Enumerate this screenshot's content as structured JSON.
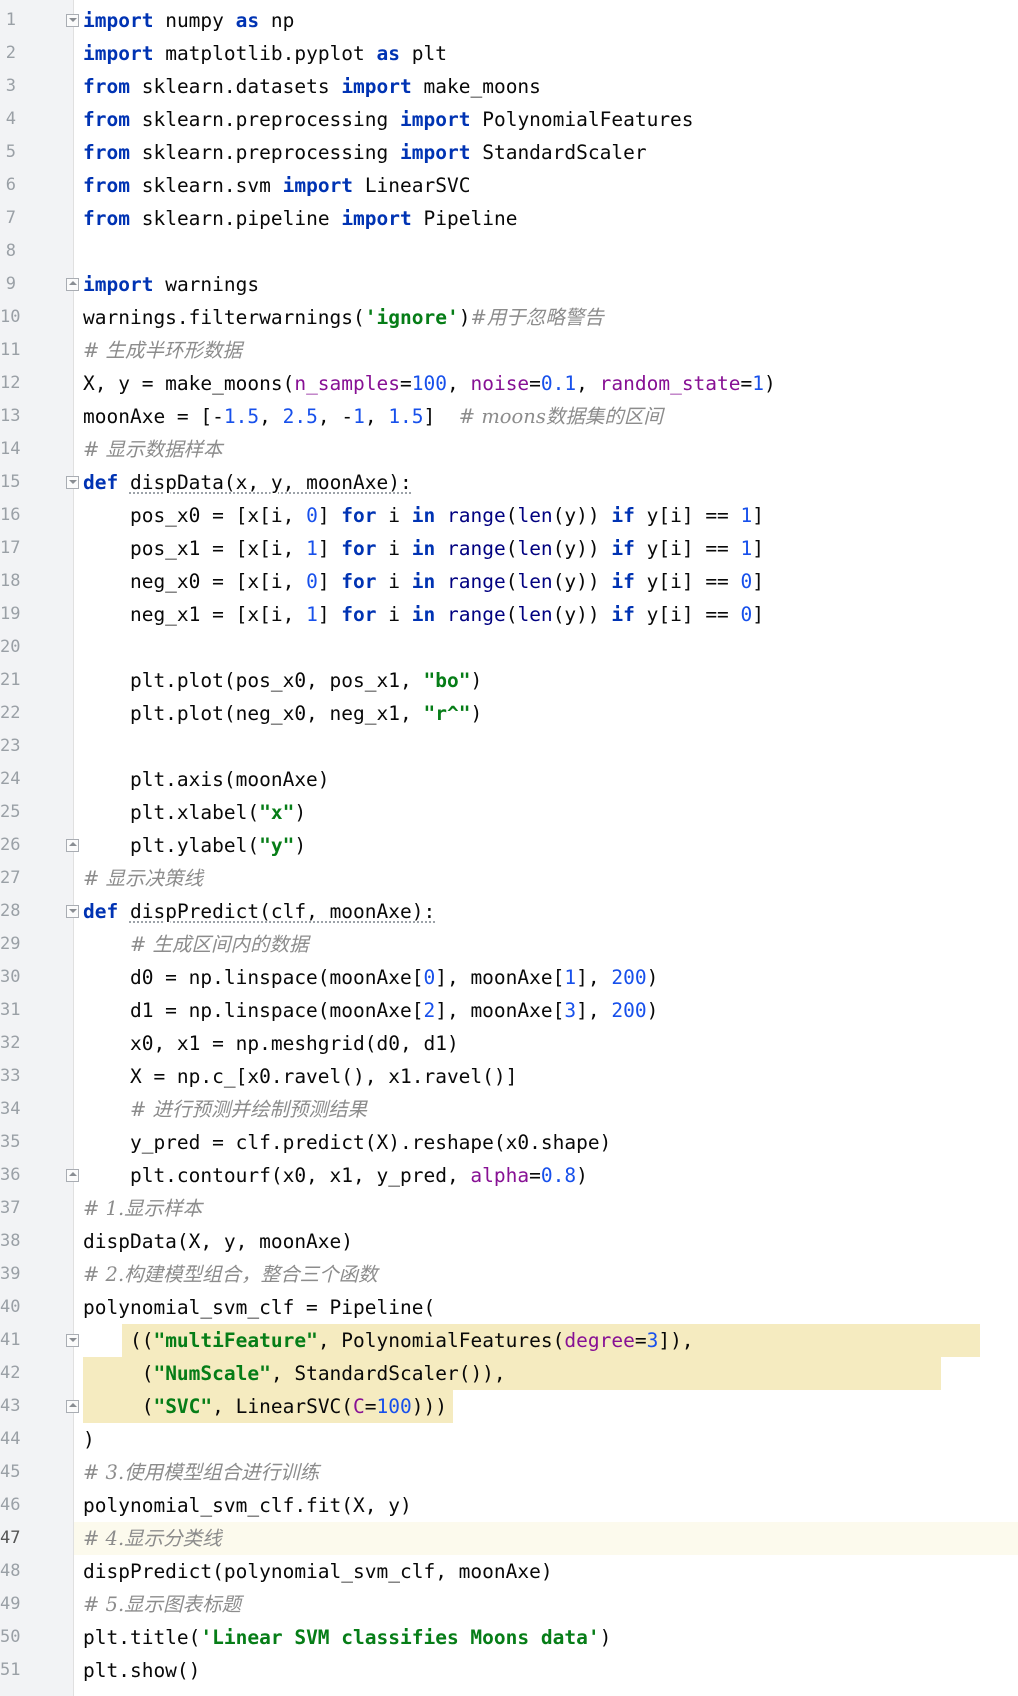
{
  "editor": {
    "line_numbers": [
      "1",
      "2",
      "3",
      "4",
      "5",
      "6",
      "7",
      "8",
      "9",
      "10",
      "11",
      "12",
      "13",
      "14",
      "15",
      "16",
      "17",
      "18",
      "19",
      "20",
      "21",
      "22",
      "23",
      "24",
      "25",
      "26",
      "27",
      "28",
      "29",
      "30",
      "31",
      "32",
      "33",
      "34",
      "35",
      "36",
      "37",
      "38",
      "39",
      "40",
      "41",
      "42",
      "43",
      "44",
      "45",
      "46",
      "47",
      "48",
      "49",
      "50",
      "51"
    ],
    "current_line": 47,
    "selected_lines": [
      41,
      42,
      43
    ],
    "fold_markers": [
      {
        "line": 1,
        "state": "open"
      },
      {
        "line": 9,
        "state": "close"
      },
      {
        "line": 15,
        "state": "open"
      },
      {
        "line": 26,
        "state": "close"
      },
      {
        "line": 28,
        "state": "open"
      },
      {
        "line": 36,
        "state": "close"
      },
      {
        "line": 41,
        "state": "open"
      },
      {
        "line": 43,
        "state": "close"
      }
    ],
    "lines": [
      [
        [
          "kw",
          "import"
        ],
        [
          "",
          "numpy"
        ],
        [
          "kw",
          "as"
        ],
        [
          "",
          "np"
        ]
      ],
      [
        [
          "kw",
          "import"
        ],
        [
          "",
          "matplotlib.pyplot"
        ],
        [
          "kw",
          "as"
        ],
        [
          "",
          "plt"
        ]
      ],
      [
        [
          "kw",
          "from"
        ],
        [
          "",
          "sklearn.datasets"
        ],
        [
          "kw",
          "import"
        ],
        [
          "",
          "make_moons"
        ]
      ],
      [
        [
          "kw",
          "from"
        ],
        [
          "",
          "sklearn.preprocessing"
        ],
        [
          "kw",
          "import"
        ],
        [
          "",
          "PolynomialFeatures"
        ]
      ],
      [
        [
          "kw",
          "from"
        ],
        [
          "",
          "sklearn.preprocessing"
        ],
        [
          "kw",
          "import"
        ],
        [
          "",
          "StandardScaler"
        ]
      ],
      [
        [
          "kw",
          "from"
        ],
        [
          "",
          "sklearn.svm"
        ],
        [
          "kw",
          "import"
        ],
        [
          "",
          "LinearSVC"
        ]
      ],
      [
        [
          "kw",
          "from"
        ],
        [
          "",
          "sklearn.pipeline"
        ],
        [
          "kw",
          "import"
        ],
        [
          "",
          "Pipeline"
        ]
      ],
      [],
      [
        [
          "kw",
          "import"
        ],
        [
          "",
          "warnings"
        ]
      ],
      [
        [
          "",
          "warnings.filterwarnings("
        ],
        [
          "str",
          "'ignore'"
        ],
        [
          "",
          ")"
        ],
        [
          "cmt",
          "#用于忽略警告"
        ]
      ],
      [
        [
          "cmt",
          "# 生成半环形数据"
        ]
      ],
      [
        [
          "",
          "X, y = make_moons("
        ],
        [
          "prm",
          "n_samples"
        ],
        [
          "",
          "="
        ],
        [
          "num",
          "100"
        ],
        [
          "",
          ", "
        ],
        [
          "prm",
          "noise"
        ],
        [
          "",
          "="
        ],
        [
          "num",
          "0.1"
        ],
        [
          "",
          ", "
        ],
        [
          "prm",
          "random_state"
        ],
        [
          "",
          "="
        ],
        [
          "num",
          "1"
        ],
        [
          "",
          ")"
        ]
      ],
      [
        [
          "",
          "moonAxe = [-"
        ],
        [
          "num",
          "1.5"
        ],
        [
          "",
          ", "
        ],
        [
          "num",
          "2.5"
        ],
        [
          "",
          ", -"
        ],
        [
          "num",
          "1"
        ],
        [
          "",
          ", "
        ],
        [
          "num",
          "1.5"
        ],
        [
          "",
          "]  "
        ],
        [
          "cmt",
          "# moons数据集的区间"
        ]
      ],
      [
        [
          "cmt",
          "# 显示数据样本"
        ]
      ],
      [
        [
          "kw",
          "def"
        ],
        [
          "",
          "dispData(x, y, moonAxe):"
        ]
      ],
      [
        [
          "",
          "    pos_x0 = [x[i, "
        ],
        [
          "num",
          "0"
        ],
        [
          "",
          "] "
        ],
        [
          "kw",
          "for"
        ],
        [
          "",
          " i "
        ],
        [
          "kw",
          "in"
        ],
        [
          "",
          ""
        ],
        [
          "bi",
          "range"
        ],
        [
          "",
          "("
        ],
        [
          "bi",
          "len"
        ],
        [
          "",
          "(y)) "
        ],
        [
          "kw",
          "if"
        ],
        [
          "",
          " y[i] == "
        ],
        [
          "num",
          "1"
        ],
        [
          "",
          "]"
        ]
      ],
      [
        [
          "",
          "    pos_x1 = [x[i, "
        ],
        [
          "num",
          "1"
        ],
        [
          "",
          "] "
        ],
        [
          "kw",
          "for"
        ],
        [
          "",
          " i "
        ],
        [
          "kw",
          "in"
        ],
        [
          "",
          ""
        ],
        [
          "bi",
          "range"
        ],
        [
          "",
          "("
        ],
        [
          "bi",
          "len"
        ],
        [
          "",
          "(y)) "
        ],
        [
          "kw",
          "if"
        ],
        [
          "",
          " y[i] == "
        ],
        [
          "num",
          "1"
        ],
        [
          "",
          "]"
        ]
      ],
      [
        [
          "",
          "    neg_x0 = [x[i, "
        ],
        [
          "num",
          "0"
        ],
        [
          "",
          "] "
        ],
        [
          "kw",
          "for"
        ],
        [
          "",
          " i "
        ],
        [
          "kw",
          "in"
        ],
        [
          "",
          ""
        ],
        [
          "bi",
          "range"
        ],
        [
          "",
          "("
        ],
        [
          "bi",
          "len"
        ],
        [
          "",
          "(y)) "
        ],
        [
          "kw",
          "if"
        ],
        [
          "",
          " y[i] == "
        ],
        [
          "num",
          "0"
        ],
        [
          "",
          "]"
        ]
      ],
      [
        [
          "",
          "    neg_x1 = [x[i, "
        ],
        [
          "num",
          "1"
        ],
        [
          "",
          "] "
        ],
        [
          "kw",
          "for"
        ],
        [
          "",
          " i "
        ],
        [
          "kw",
          "in"
        ],
        [
          "",
          ""
        ],
        [
          "bi",
          "range"
        ],
        [
          "",
          "("
        ],
        [
          "bi",
          "len"
        ],
        [
          "",
          "(y)) "
        ],
        [
          "kw",
          "if"
        ],
        [
          "",
          " y[i] == "
        ],
        [
          "num",
          "0"
        ],
        [
          "",
          "]"
        ]
      ],
      [],
      [
        [
          "",
          "    plt.plot(pos_x0, pos_x1, "
        ],
        [
          "str",
          "\"bo\""
        ],
        [
          "",
          ")"
        ]
      ],
      [
        [
          "",
          "    plt.plot(neg_x0, neg_x1, "
        ],
        [
          "str",
          "\"r^\""
        ],
        [
          "",
          ")"
        ]
      ],
      [],
      [
        [
          "",
          "    plt.axis(moonAxe)"
        ]
      ],
      [
        [
          "",
          "    plt.xlabel("
        ],
        [
          "str",
          "\"x\""
        ],
        [
          "",
          ")"
        ]
      ],
      [
        [
          "",
          "    plt.ylabel("
        ],
        [
          "str",
          "\"y\""
        ],
        [
          "",
          ")"
        ]
      ],
      [
        [
          "cmt",
          "# 显示决策线"
        ]
      ],
      [
        [
          "kw",
          "def"
        ],
        [
          "",
          "dispPredict(clf, moonAxe):"
        ]
      ],
      [
        [
          "",
          "    "
        ],
        [
          "cmt",
          "# 生成区间内的数据"
        ]
      ],
      [
        [
          "",
          "    d0 = np.linspace(moonAxe["
        ],
        [
          "num",
          "0"
        ],
        [
          "",
          "], moonAxe["
        ],
        [
          "num",
          "1"
        ],
        [
          "",
          "], "
        ],
        [
          "num",
          "200"
        ],
        [
          "",
          ")"
        ]
      ],
      [
        [
          "",
          "    d1 = np.linspace(moonAxe["
        ],
        [
          "num",
          "2"
        ],
        [
          "",
          "], moonAxe["
        ],
        [
          "num",
          "3"
        ],
        [
          "",
          "], "
        ],
        [
          "num",
          "200"
        ],
        [
          "",
          ")"
        ]
      ],
      [
        [
          "",
          "    x0, x1 = np.meshgrid(d0, d1)"
        ]
      ],
      [
        [
          "",
          "    X = np.c_[x0.ravel(), x1.ravel()]"
        ]
      ],
      [
        [
          "",
          "    "
        ],
        [
          "cmt",
          "# 进行预测并绘制预测结果"
        ]
      ],
      [
        [
          "",
          "    y_pred = clf.predict(X).reshape(x0.shape)"
        ]
      ],
      [
        [
          "",
          "    plt.contourf(x0, x1, y_pred, "
        ],
        [
          "prm",
          "alpha"
        ],
        [
          "",
          "="
        ],
        [
          "num",
          "0.8"
        ],
        [
          "",
          ")"
        ]
      ],
      [
        [
          "cmt",
          "# 1.显示样本"
        ]
      ],
      [
        [
          "",
          "dispData(X, y, moonAxe)"
        ]
      ],
      [
        [
          "cmt",
          "# 2.构建模型组合，整合三个函数"
        ]
      ],
      [
        [
          "",
          "polynomial_svm_clf = Pipeline("
        ]
      ],
      [
        [
          "",
          "    (("
        ],
        [
          "str",
          "\"multiFeature\""
        ],
        [
          "",
          ", PolynomialFeatures("
        ],
        [
          "prm",
          "degree"
        ],
        [
          "",
          "="
        ],
        [
          "num",
          "3"
        ],
        [
          "",
          "]),"
        ]
      ],
      [
        [
          "",
          "     ("
        ],
        [
          "str",
          "\"NumScale\""
        ],
        [
          "",
          ", StandardScaler()),"
        ]
      ],
      [
        [
          "",
          "     ("
        ],
        [
          "str",
          "\"SVC\""
        ],
        [
          "",
          ", LinearSVC("
        ],
        [
          "prm",
          "C"
        ],
        [
          "",
          "="
        ],
        [
          "num",
          "100"
        ],
        [
          "",
          ")))"
        ]
      ],
      [
        [
          "",
          ")"
        ]
      ],
      [
        [
          "cmt",
          "# 3.使用模型组合进行训练"
        ]
      ],
      [
        [
          "",
          "polynomial_svm_clf.fit(X, y)"
        ]
      ],
      [
        [
          "cmt",
          "# 4.显示分类线"
        ]
      ],
      [
        [
          "",
          "dispPredict(polynomial_svm_clf, moonAxe)"
        ]
      ],
      [
        [
          "cmt",
          "# 5.显示图表标题"
        ]
      ],
      [
        [
          "",
          "plt.title("
        ],
        [
          "str",
          "'Linear SVM classifies Moons data'"
        ],
        [
          "",
          ")"
        ]
      ],
      [
        [
          "",
          "plt.show()"
        ]
      ]
    ]
  }
}
